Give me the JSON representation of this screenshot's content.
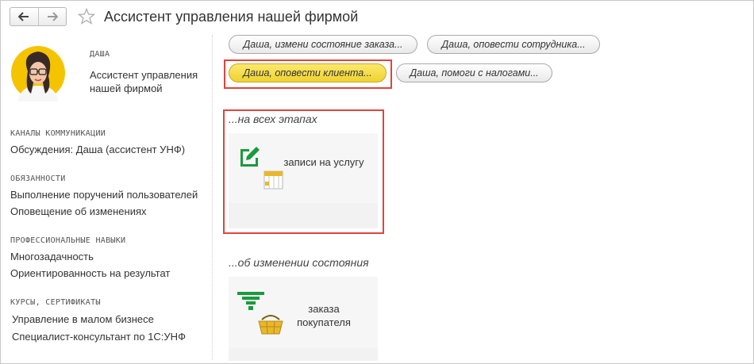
{
  "window": {
    "title": "Ассистент управления нашей фирмой",
    "back_icon": "arrow-left-icon",
    "forward_icon": "arrow-right-icon",
    "favorite_icon": "star-outline-icon"
  },
  "agent": {
    "name": "ДАША",
    "role": "Ассистент управления нашей фирмой",
    "avatar_icon": "avatar-woman-glasses"
  },
  "sidebar": {
    "sections": [
      {
        "heading": "КАНАЛЫ КОММУНИКАЦИИ",
        "items": [
          "Обсуждения: Даша (ассистент УНФ)"
        ]
      },
      {
        "heading": "ОБЯЗАННОСТИ",
        "items": [
          "Выполнение поручений пользователей",
          "Оповещение об изменениях"
        ]
      },
      {
        "heading": "ПРОФЕССИОНАЛЬНЫЕ НАВЫКИ",
        "items": [
          "Многозадачность",
          "Ориентированность на результат"
        ]
      },
      {
        "heading": "КУРСЫ, СЕРТИФИКАТЫ",
        "items": [
          "Управление в малом бизнесе",
          "Специалист-консультант по 1С:УНФ"
        ]
      }
    ]
  },
  "quick_actions": [
    {
      "label": "Даша, измени состояние заказа...",
      "active": false
    },
    {
      "label": "Даша, оповести сотрудника...",
      "active": false
    },
    {
      "label": "Даша, оповести клиента...",
      "active": true
    },
    {
      "label": "Даша, помоги с налогами...",
      "active": false
    }
  ],
  "sections": [
    {
      "title": "...на всех этапах",
      "card": {
        "label": "записи на услугу",
        "icon": "edit-calendar-icon"
      }
    },
    {
      "title": "...об изменении состояния",
      "card": {
        "label": "заказа покупателя",
        "icon": "funnel-basket-icon"
      }
    }
  ],
  "colors": {
    "highlight_border": "#e0443e",
    "active_button": "#f4dc45",
    "icon_green": "#1a9a3e",
    "icon_yellow": "#e8b82a"
  }
}
